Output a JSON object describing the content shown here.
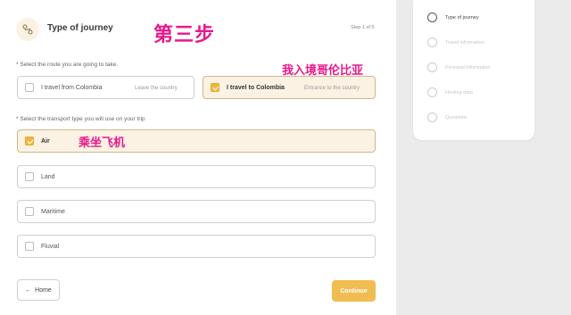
{
  "header": {
    "title": "Type of journey",
    "step_indicator": "Step 1 of 5"
  },
  "annotations": {
    "step": "第三步",
    "enter_colombia": "我入境哥伦比亚",
    "by_air": "乘坐飞机"
  },
  "route": {
    "question": "* Select the route you are going to take.",
    "options": [
      {
        "label": "I travel from Colombia",
        "sub": "Leave the country",
        "selected": false
      },
      {
        "label": "I travel to Colombia",
        "sub": "Entrance to the country",
        "selected": true
      }
    ]
  },
  "transport": {
    "question": "* Select the transport type you will use on your trip",
    "options": [
      {
        "label": "Air",
        "selected": true
      },
      {
        "label": "Land",
        "selected": false
      },
      {
        "label": "Maritime",
        "selected": false
      },
      {
        "label": "Fluvial",
        "selected": false
      }
    ]
  },
  "buttons": {
    "home": "Home",
    "home_arrow": "←",
    "continue": "Continue"
  },
  "steps": [
    {
      "label": "Type of journey",
      "active": true
    },
    {
      "label": "Travel information",
      "active": false
    },
    {
      "label": "Personal information",
      "active": false
    },
    {
      "label": "Hosting data",
      "active": false
    },
    {
      "label": "Questions",
      "active": false
    }
  ],
  "colors": {
    "accent": "#f1bd50",
    "selected_bg": "#fbf2e3",
    "annotation": "#e8198b"
  }
}
